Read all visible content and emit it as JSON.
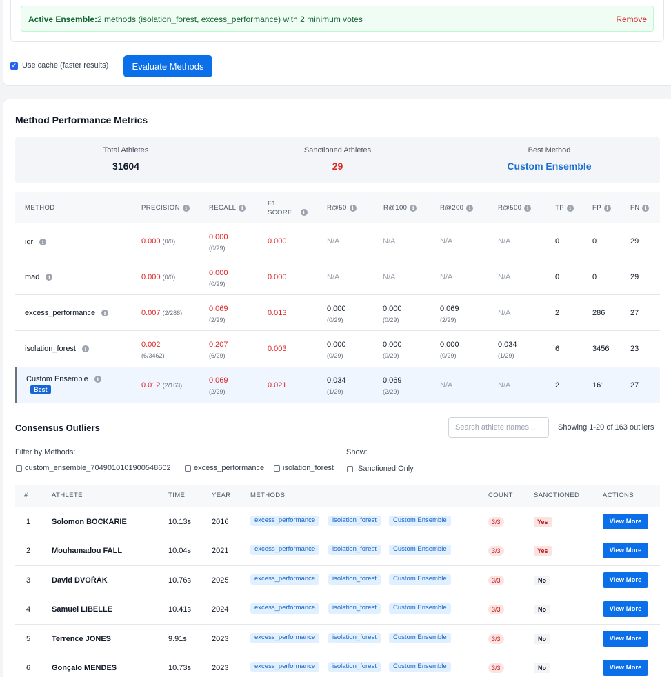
{
  "ensemble": {
    "label": "Active Ensemble:",
    "text": "2 methods (isolation_forest, excess_performance) with 2 minimum votes",
    "remove": "Remove"
  },
  "cache": {
    "label": "Use cache (faster results)",
    "checked": true
  },
  "evaluate_button": "Evaluate Methods",
  "metrics": {
    "title": "Method Performance Metrics",
    "summary": {
      "total_label": "Total Athletes",
      "total_value": "31604",
      "sanctioned_label": "Sanctioned Athletes",
      "sanctioned_value": "29",
      "best_label": "Best Method",
      "best_value": "Custom Ensemble"
    },
    "headers": [
      "METHOD",
      "PRECISION",
      "RECALL",
      "F1",
      "SCORE",
      "R@50",
      "R@100",
      "R@200",
      "R@500",
      "TP",
      "FP",
      "FN"
    ],
    "best_badge": "Best",
    "rows": [
      {
        "method": "iqr",
        "precision": "0.000",
        "precision_sub": "(0/0)",
        "recall": "0.000",
        "recall_sub": "(0/29)",
        "f1": "0.000",
        "r50": "N/A",
        "r50_sub": "",
        "r100": "N/A",
        "r100_sub": "",
        "r200": "N/A",
        "r200_sub": "",
        "r500": "N/A",
        "r500_sub": "",
        "tp": "0",
        "fp": "0",
        "fn": "29"
      },
      {
        "method": "mad",
        "precision": "0.000",
        "precision_sub": "(0/0)",
        "recall": "0.000",
        "recall_sub": "(0/29)",
        "f1": "0.000",
        "r50": "N/A",
        "r50_sub": "",
        "r100": "N/A",
        "r100_sub": "",
        "r200": "N/A",
        "r200_sub": "",
        "r500": "N/A",
        "r500_sub": "",
        "tp": "0",
        "fp": "0",
        "fn": "29"
      },
      {
        "method": "excess_performance",
        "precision": "0.007",
        "precision_sub": "(2/288)",
        "recall": "0.069",
        "recall_sub": "(2/29)",
        "f1": "0.013",
        "r50": "0.000",
        "r50_sub": "(0/29)",
        "r100": "0.000",
        "r100_sub": "(0/29)",
        "r200": "0.069",
        "r200_sub": "(2/29)",
        "r500": "N/A",
        "r500_sub": "",
        "tp": "2",
        "fp": "286",
        "fn": "27"
      },
      {
        "method": "isolation_forest",
        "precision": "0.002",
        "precision_sub": "(6/3462)",
        "recall": "0.207",
        "recall_sub": "(6/29)",
        "f1": "0.003",
        "r50": "0.000",
        "r50_sub": "(0/29)",
        "r100": "0.000",
        "r100_sub": "(0/29)",
        "r200": "0.000",
        "r200_sub": "(0/29)",
        "r500": "0.034",
        "r500_sub": "(1/29)",
        "tp": "6",
        "fp": "3456",
        "fn": "23"
      },
      {
        "method": "Custom Ensemble",
        "precision": "0.012",
        "precision_sub": "(2/163)",
        "recall": "0.069",
        "recall_sub": "(2/29)",
        "f1": "0.021",
        "r50": "0.034",
        "r50_sub": "(1/29)",
        "r100": "0.069",
        "r100_sub": "(2/29)",
        "r200": "N/A",
        "r200_sub": "",
        "r500": "N/A",
        "r500_sub": "",
        "tp": "2",
        "fp": "161",
        "fn": "27"
      }
    ]
  },
  "outliers": {
    "title": "Consensus Outliers",
    "search_placeholder": "Search athlete names...",
    "showing": "Showing 1-20 of 163 outliers",
    "filter_label": "Filter by Methods:",
    "filter_options": [
      "custom_ensemble_7049010101900548602",
      "excess_performance",
      "isolation_forest"
    ],
    "show_label": "Show:",
    "sanctioned_only": "Sanctioned Only",
    "headers": [
      "#",
      "ATHLETE",
      "TIME",
      "YEAR",
      "METHODS",
      "COUNT",
      "SANCTIONED",
      "ACTIONS"
    ],
    "view_more": "View More",
    "rows": [
      {
        "idx": "1",
        "athlete": "Solomon BOCKARIE",
        "time": "10.13s",
        "year": "2016",
        "methods": [
          "excess_performance",
          "isolation_forest",
          "Custom Ensemble"
        ],
        "count": "3/3",
        "sanctioned": "Yes"
      },
      {
        "idx": "2",
        "athlete": "Mouhamadou FALL",
        "time": "10.04s",
        "year": "2021",
        "methods": [
          "excess_performance",
          "isolation_forest",
          "Custom Ensemble"
        ],
        "count": "3/3",
        "sanctioned": "Yes"
      },
      {
        "idx": "3",
        "athlete": "David DVOŘÁK",
        "time": "10.76s",
        "year": "2025",
        "methods": [
          "excess_performance",
          "isolation_forest",
          "Custom Ensemble"
        ],
        "count": "3/3",
        "sanctioned": "No"
      },
      {
        "idx": "4",
        "athlete": "Samuel LIBELLE",
        "time": "10.41s",
        "year": "2024",
        "methods": [
          "excess_performance",
          "isolation_forest",
          "Custom Ensemble"
        ],
        "count": "3/3",
        "sanctioned": "No"
      },
      {
        "idx": "5",
        "athlete": "Terrence JONES",
        "time": "9.91s",
        "year": "2023",
        "methods": [
          "excess_performance",
          "isolation_forest",
          "Custom Ensemble"
        ],
        "count": "3/3",
        "sanctioned": "No"
      },
      {
        "idx": "6",
        "athlete": "Gonçalo MENDES",
        "time": "10.73s",
        "year": "2023",
        "methods": [
          "excess_performance",
          "isolation_forest",
          "Custom Ensemble"
        ],
        "count": "3/3",
        "sanctioned": "No"
      }
    ]
  }
}
